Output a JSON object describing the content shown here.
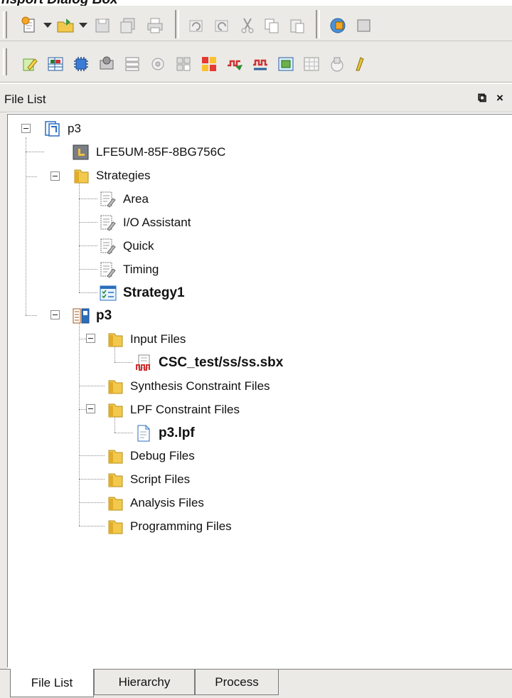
{
  "caption": "nsport Dialog Box",
  "toolbar_top": {
    "buttons": [
      "new-project-icon",
      "open-project-icon",
      "save-icon",
      "save-all-icon",
      "print-icon",
      "undo-icon",
      "redo-icon",
      "cut-icon",
      "copy-icon",
      "paste-icon",
      "ipexpress-icon"
    ]
  },
  "toolbar_bottom": {
    "buttons": [
      "edit-icon",
      "spreadsheet-icon",
      "chip-icon",
      "netlist-icon",
      "floorplan-icon",
      "package-icon",
      "placement-icon",
      "clarity-icon",
      "timing-icon",
      "reveal-icon",
      "power-icon",
      "ecoeditor-icon",
      "programmer-icon",
      "analyzer-icon"
    ]
  },
  "panel": {
    "title": "File List",
    "float_glyph": "⧉",
    "close_glyph": "×"
  },
  "tree": {
    "project": "p3",
    "device": "LFE5UM-85F-8BG756C",
    "strategies": "Strategies",
    "strategy_items": [
      "Area",
      "I/O Assistant",
      "Quick",
      "Timing",
      "Strategy1"
    ],
    "implementation": "p3",
    "input_files": "Input Files",
    "input_file": "CSC_test/ss/ss.sbx",
    "synthesis_constraints": "Synthesis Constraint Files",
    "lpf_constraints": "LPF Constraint Files",
    "lpf_file": "p3.lpf",
    "debug_files": "Debug Files",
    "script_files": "Script Files",
    "analysis_files": "Analysis Files",
    "programming_files": "Programming Files"
  },
  "tabs": [
    "File List",
    "Hierarchy",
    "Process"
  ],
  "active_tab": "File List"
}
